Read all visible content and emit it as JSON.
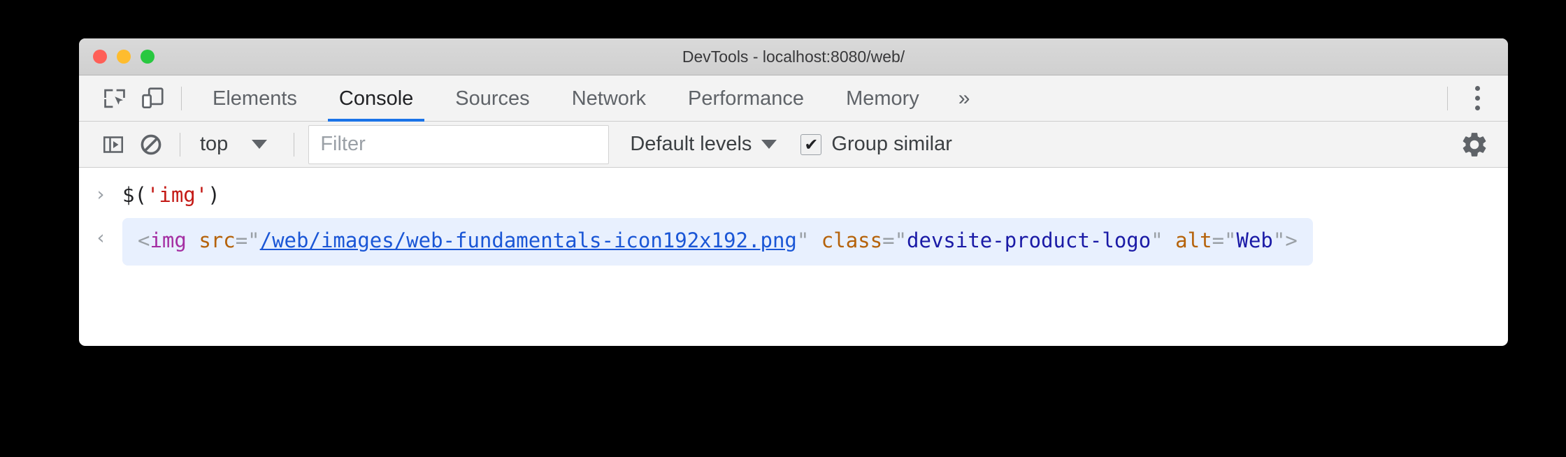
{
  "window": {
    "title": "DevTools - localhost:8080/web/",
    "traffic_lights": [
      {
        "name": "close",
        "color": "#ff5f57"
      },
      {
        "name": "minimize",
        "color": "#febc2e"
      },
      {
        "name": "zoom",
        "color": "#28c840"
      }
    ]
  },
  "tabstrip": {
    "icons": [
      {
        "name": "inspect-element-icon"
      },
      {
        "name": "device-toolbar-icon"
      }
    ],
    "tabs": [
      {
        "label": "Elements",
        "active": false
      },
      {
        "label": "Console",
        "active": true
      },
      {
        "label": "Sources",
        "active": false
      },
      {
        "label": "Network",
        "active": false
      },
      {
        "label": "Performance",
        "active": false
      },
      {
        "label": "Memory",
        "active": false
      }
    ],
    "overflow_label": "»",
    "accent_color": "#1a73e8"
  },
  "console_toolbar": {
    "sidebar_toggle_icon": "console-sidebar-icon",
    "clear_icon": "clear-console-icon",
    "context": "top",
    "filter_placeholder": "Filter",
    "filter_value": "",
    "levels_label": "Default levels",
    "group_similar_label": "Group similar",
    "group_similar_checked": true,
    "settings_icon": "gear-icon"
  },
  "console": {
    "input": {
      "prompt": "›",
      "tokens": [
        {
          "text": "$(",
          "type": "plain"
        },
        {
          "text": "'img'",
          "type": "string"
        },
        {
          "text": ")",
          "type": "plain"
        }
      ],
      "raw": "$('img')"
    },
    "result": {
      "prompt": "‹",
      "tokens": [
        {
          "text": "<",
          "type": "punct"
        },
        {
          "text": "img",
          "type": "tag"
        },
        {
          "text": " ",
          "type": "plain"
        },
        {
          "text": "src",
          "type": "attr"
        },
        {
          "text": "=\"",
          "type": "eq"
        },
        {
          "text": "/web/images/web-fundamentals-icon192x192.png",
          "type": "link"
        },
        {
          "text": "\"",
          "type": "eq"
        },
        {
          "text": " ",
          "type": "plain"
        },
        {
          "text": "class",
          "type": "attr"
        },
        {
          "text": "=\"",
          "type": "eq"
        },
        {
          "text": "devsite-product-logo",
          "type": "value"
        },
        {
          "text": "\"",
          "type": "eq"
        },
        {
          "text": " ",
          "type": "plain"
        },
        {
          "text": "alt",
          "type": "attr"
        },
        {
          "text": "=\"",
          "type": "eq"
        },
        {
          "text": "Web",
          "type": "value"
        },
        {
          "text": "\"",
          "type": "eq"
        },
        {
          "text": ">",
          "type": "punct"
        }
      ],
      "raw": "<img src=\"/web/images/web-fundamentals-icon192x192.png\" class=\"devsite-product-logo\" alt=\"Web\">"
    }
  }
}
